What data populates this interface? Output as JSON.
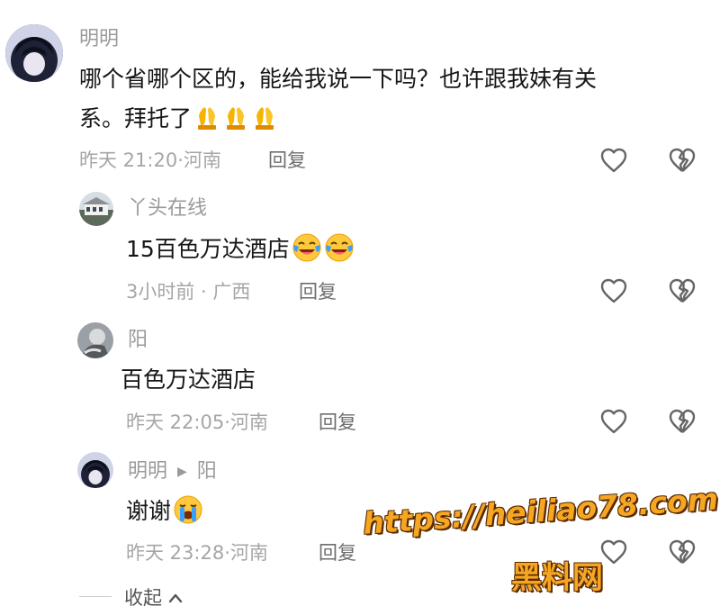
{
  "comments": [
    {
      "user": "明明",
      "text_line1": "哪个省哪个区的，能给我说一下吗？也许跟我妹有关",
      "text_line2": "系。拜托了",
      "emojis": [
        "folded-hands-emoji",
        "folded-hands-emoji",
        "folded-hands-emoji"
      ],
      "time": "昨天 21:20",
      "location": "河南",
      "reply_label": "回复"
    },
    {
      "user": "丫头在线",
      "text": "15百色万达酒店",
      "emojis": [
        "crying-laughing-emoji",
        "crying-laughing-emoji"
      ],
      "time": "3小时前",
      "location": "广西",
      "reply_label": "回复"
    },
    {
      "user": "阳",
      "text": "百色万达酒店",
      "time": "昨天 22:05",
      "location": "河南",
      "reply_label": "回复"
    },
    {
      "user": "明明",
      "reply_to": "阳",
      "text": "谢谢",
      "emojis": [
        "crying-emoji"
      ],
      "time": "昨天 23:28",
      "location": "河南",
      "reply_label": "回复"
    }
  ],
  "collapse_label": "收起",
  "watermark": {
    "url": "https://heiliao78.com",
    "name": "黑料网"
  },
  "colors": {
    "username": "#9a9a9a",
    "meta": "#a6a6a6",
    "watermark": "#f5a623"
  }
}
